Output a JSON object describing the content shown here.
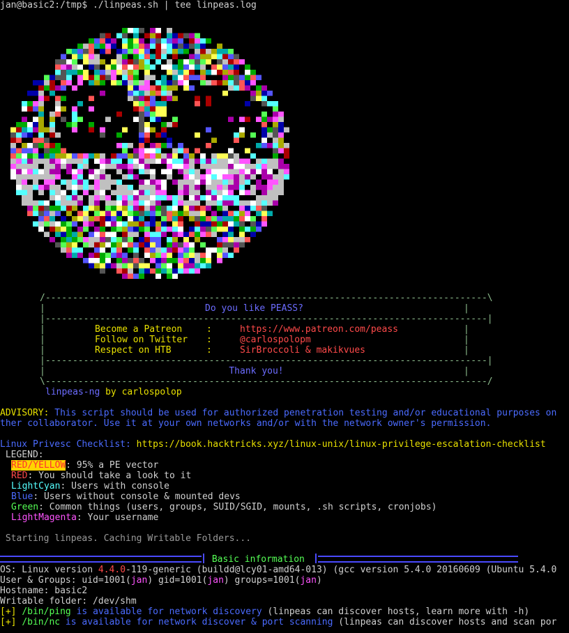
{
  "prompt": "jan@basic2:/tmp$ ./linpeas.sh | tee linpeas.log",
  "banner": {
    "question": "Do you like PEASS?",
    "rows": [
      {
        "label": "Become a Patreon",
        "value": "https://www.patreon.com/peass"
      },
      {
        "label": "Follow on Twitter",
        "value": "@carlospolopm"
      },
      {
        "label": "Respect on HTB",
        "value": "SirBroccoli & makikvues"
      }
    ],
    "thanks": "Thank you!",
    "sig_name": "linpeas-ng",
    "sig_by": " by carlospolop"
  },
  "advisory": {
    "label": "ADVISORY:",
    "line1": " This script should be used for authorized penetration testing and/or educational purposes on",
    "line2": "ther collaborator. Use it at your own networks and/or with the network owner's permission."
  },
  "checklist": {
    "label": "Linux Privesc Checklist:",
    "url": " https://book.hacktricks.xyz/linux-unix/linux-privilege-escalation-checklist"
  },
  "legend": {
    "title": " LEGEND:",
    "items": [
      {
        "key": "RED/YELLOW",
        "text": ": 95% a PE vector"
      },
      {
        "key": "RED",
        "text": ": You should take a look to it"
      },
      {
        "key": "LightCyan",
        "text": ": Users with console"
      },
      {
        "key": "Blue",
        "text": ": Users without console & mounted devs"
      },
      {
        "key": "Green",
        "text": ": Common things (users, groups, SUID/SGID, mounts, .sh scripts, cronjobs)"
      },
      {
        "key": "LightMagenta",
        "text": ": Your username"
      }
    ]
  },
  "starting": " Starting linpeas. Caching Writable Folders...",
  "section_title": " Basic information ",
  "info": {
    "os_label": "OS: Linux version ",
    "os_ver": "4.4.0",
    "os_rest": "-119-generic (buildd@lcy01-amd64-013) (gcc version 5.4.0 20160609 (Ubuntu 5.4.0",
    "ug_label": "User & Groups: uid=1001(",
    "user": "jan",
    "ug_mid": ") gid=1001(",
    "ug_mid2": ") groups=1001(",
    "ug_end": ")",
    "hostname": "Hostname: basic2",
    "writable": "Writable folder: /dev/shm",
    "ping_prefix": "[+] ",
    "ping_path": "/bin/ping",
    "ping_avail": " is available for network discovery",
    "ping_note": " (linpeas can discover hosts, learn more with -h)",
    "nc_prefix": "[+] ",
    "nc_path": "/bin/nc",
    "nc_avail": " is available for network discover & port scanning",
    "nc_note": " (linpeas can discover hosts and scan por"
  },
  "colors": {
    "ascii_palette": [
      "#c0c0c0",
      "#ffff55",
      "#00aaaa",
      "#aa00aa",
      "#00aa00",
      "#0000aa",
      "#ff55ff",
      "#55ffff",
      "#55ff55",
      "#5555ff",
      "#ff5555",
      "#aa0000",
      "#aaaa00",
      "#555555",
      "#ffffff"
    ]
  }
}
